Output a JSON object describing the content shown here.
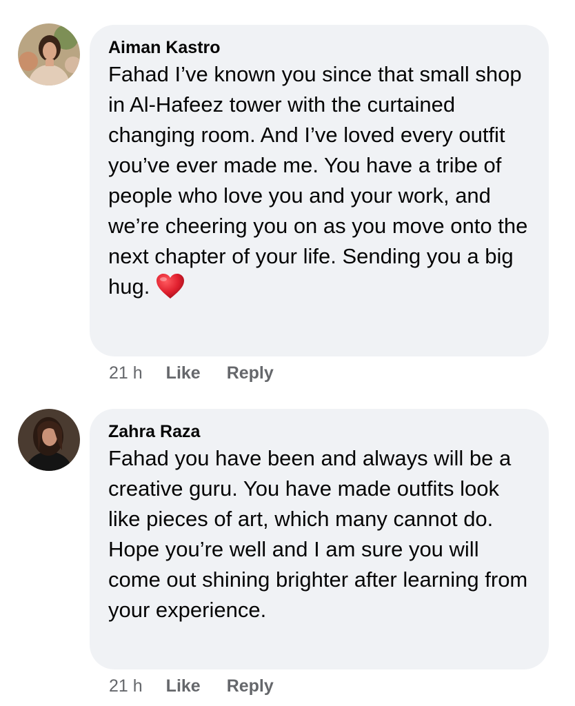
{
  "comments": [
    {
      "author": "Aiman Kastro",
      "text": "Fahad I’ve known you since that small shop in Al-Hafeez tower with the curtained changing room. And I’ve loved every outfit you’ve ever made me. You have a tribe of people who love you and your work, and we’re cheering you on as you move onto the next chapter of your life. Sending you a big hug.",
      "reaction_icon": "red-heart-emoji",
      "time": "21 h",
      "like_label": "Like",
      "reply_label": "Reply"
    },
    {
      "author": "Zahra Raza",
      "text": "Fahad you have been and always will be a creative guru. You have made outfits  look like pieces of art, which many cannot do. Hope you’re well and I am sure you will come out shining brighter after learning from your experience.",
      "time": "21 h",
      "like_label": "Like",
      "reply_label": "Reply"
    }
  ],
  "colors": {
    "bubble": "#f0f2f5",
    "text": "#050505",
    "meta": "#65676b",
    "heart": "#e0202e"
  }
}
